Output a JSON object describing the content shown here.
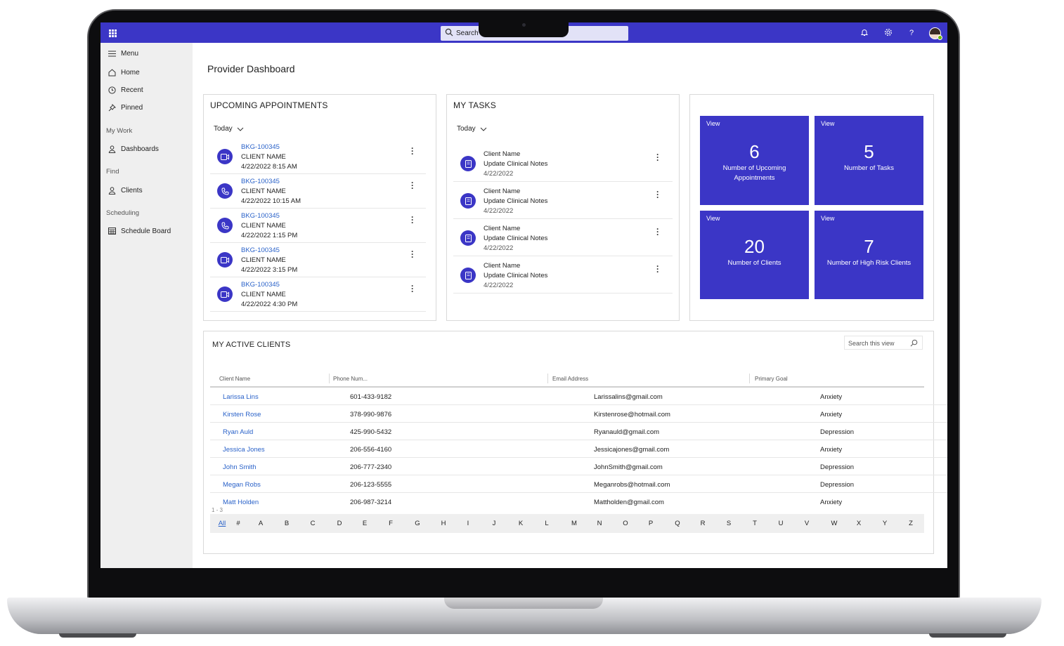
{
  "topbar": {
    "search_label": "Search",
    "icons": [
      "waffle-icon",
      "search-icon",
      "bell-icon",
      "gear-icon",
      "help-icon",
      "avatar"
    ]
  },
  "sidebar": {
    "menu": "Menu",
    "home": "Home",
    "recent": "Recent",
    "pinned": "Pinned",
    "my_work_section": "My Work",
    "dashboards": "Dashboards",
    "find_section": "Find",
    "clients": "Clients",
    "scheduling_section": "Scheduling",
    "schedule_board": "Schedule Board"
  },
  "page": {
    "title": "Provider Dashboard"
  },
  "appointments": {
    "title": "UPCOMING APPOINTMENTS",
    "filter": "Today",
    "items": [
      {
        "id": "BKG-100345",
        "name": "CLIENT NAME",
        "time": "4/22/2022 8:15 AM",
        "icon": "video-icon"
      },
      {
        "id": "BKG-100345",
        "name": "CLIENT NAME",
        "time": "4/22/2022 10:15 AM",
        "icon": "phone-icon"
      },
      {
        "id": "BKG-100345",
        "name": "CLIENT NAME",
        "time": "4/22/2022 1:15 PM",
        "icon": "phone-icon"
      },
      {
        "id": "BKG-100345",
        "name": "CLIENT NAME",
        "time": "4/22/2022 3:15 PM",
        "icon": "video-icon"
      },
      {
        "id": "BKG-100345",
        "name": "CLIENT NAME",
        "time": "4/22/2022 4:30 PM",
        "icon": "video-icon"
      }
    ]
  },
  "tasks": {
    "title": "MY TASKS",
    "filter": "Today",
    "items": [
      {
        "name": "Client Name",
        "task": "Update Clinical Notes",
        "date": "4/22/2022"
      },
      {
        "name": "Client Name",
        "task": "Update Clinical Notes",
        "date": "4/22/2022"
      },
      {
        "name": "Client Name",
        "task": "Update Clinical Notes",
        "date": "4/22/2022"
      },
      {
        "name": "Client Name",
        "task": "Update Clinical Notes",
        "date": "4/22/2022"
      }
    ]
  },
  "tiles": [
    {
      "view": "View",
      "number": "6",
      "label": "Number of Upcoming Appointments"
    },
    {
      "view": "View",
      "number": "5",
      "label": "Number of Tasks"
    },
    {
      "view": "View",
      "number": "20",
      "label": "Number of Clients"
    },
    {
      "view": "View",
      "number": "7",
      "label": "Number of High Risk Clients"
    }
  ],
  "clients": {
    "title": "MY ACTIVE CLIENTS",
    "search_placeholder": "Search this view",
    "columns": [
      "Client Name",
      "Phone Num...",
      "Email Address",
      "Primary Goal"
    ],
    "rows": [
      {
        "name": "Larissa Lins",
        "phone": "601-433-9182",
        "email": "Larissalins@gmail.com",
        "goal": "Anxiety"
      },
      {
        "name": "Kirsten Rose",
        "phone": "378-990-9876",
        "email": "Kirstenrose@hotmail.com",
        "goal": "Anxiety"
      },
      {
        "name": "Ryan Auld",
        "phone": "425-990-5432",
        "email": "Ryanauld@gmail.com",
        "goal": "Depression"
      },
      {
        "name": "Jessica Jones",
        "phone": "206-556-4160",
        "email": "Jessicajones@gmail.com",
        "goal": "Anxiety"
      },
      {
        "name": "John Smith",
        "phone": "206-777-2340",
        "email": "JohnSmith@gmail.com",
        "goal": "Depression"
      },
      {
        "name": "Megan Robs",
        "phone": "206-123-5555",
        "email": "Meganrobs@hotmail.com",
        "goal": "Depression"
      },
      {
        "name": "Matt Holden",
        "phone": "206-987-3214",
        "email": "Mattholden@gmail.com",
        "goal": "Anxiety"
      }
    ],
    "record_count": "1 - 3",
    "alphabet": [
      "All",
      "#",
      "A",
      "B",
      "C",
      "D",
      "E",
      "F",
      "G",
      "H",
      "I",
      "J",
      "K",
      "L",
      "M",
      "N",
      "O",
      "P",
      "Q",
      "R",
      "S",
      "T",
      "U",
      "V",
      "W",
      "X",
      "Y",
      "Z"
    ],
    "active_letter": "All"
  },
  "colors": {
    "brand": "#3b36c6",
    "link": "#2a62c9",
    "sidebar_bg": "#efefef"
  }
}
